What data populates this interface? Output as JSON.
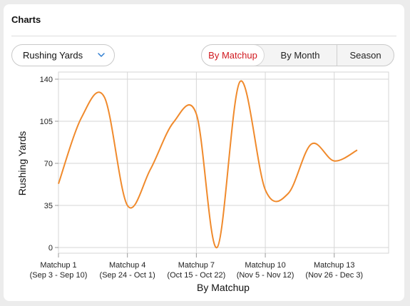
{
  "panel": {
    "title": "Charts"
  },
  "controls": {
    "metric_select": {
      "selected": "Rushing Yards",
      "icon": "chevron-down-icon"
    },
    "view_tabs": [
      {
        "label": "By Matchup",
        "active": true
      },
      {
        "label": "By Month",
        "active": false
      },
      {
        "label": "Season",
        "active": false
      }
    ]
  },
  "colors": {
    "line": "#f08a2c",
    "active_tab_text": "#d0191f",
    "chevron": "#2f7dd1",
    "grid": "#d6d6d6"
  },
  "chart_data": {
    "type": "line",
    "xlabel": "By Matchup",
    "ylabel": "Rushing Yards",
    "ylim": [
      0,
      140
    ],
    "yticks": [
      0,
      35,
      70,
      105,
      140
    ],
    "grid": true,
    "x_tick_labels": [
      {
        "matchup": "Matchup 1",
        "dates": "(Sep 3 - Sep 10)"
      },
      {
        "matchup": "Matchup 4",
        "dates": "(Sep 24 - Oct 1)"
      },
      {
        "matchup": "Matchup 7",
        "dates": "(Oct 15 - Oct 22)"
      },
      {
        "matchup": "Matchup 10",
        "dates": "(Nov 5 - Nov 12)"
      },
      {
        "matchup": "Matchup 13",
        "dates": "(Nov 26 - Dec 3)"
      }
    ],
    "x_tick_positions": [
      1,
      4,
      7,
      10,
      13
    ],
    "series": [
      {
        "x": [
          1,
          2,
          3,
          4,
          5,
          6,
          7,
          7.9,
          8.9,
          10,
          11,
          12,
          13,
          14
        ],
        "values": [
          53,
          108,
          125,
          35,
          65,
          104,
          111,
          0,
          138,
          48,
          45,
          86,
          72,
          81
        ]
      }
    ]
  }
}
